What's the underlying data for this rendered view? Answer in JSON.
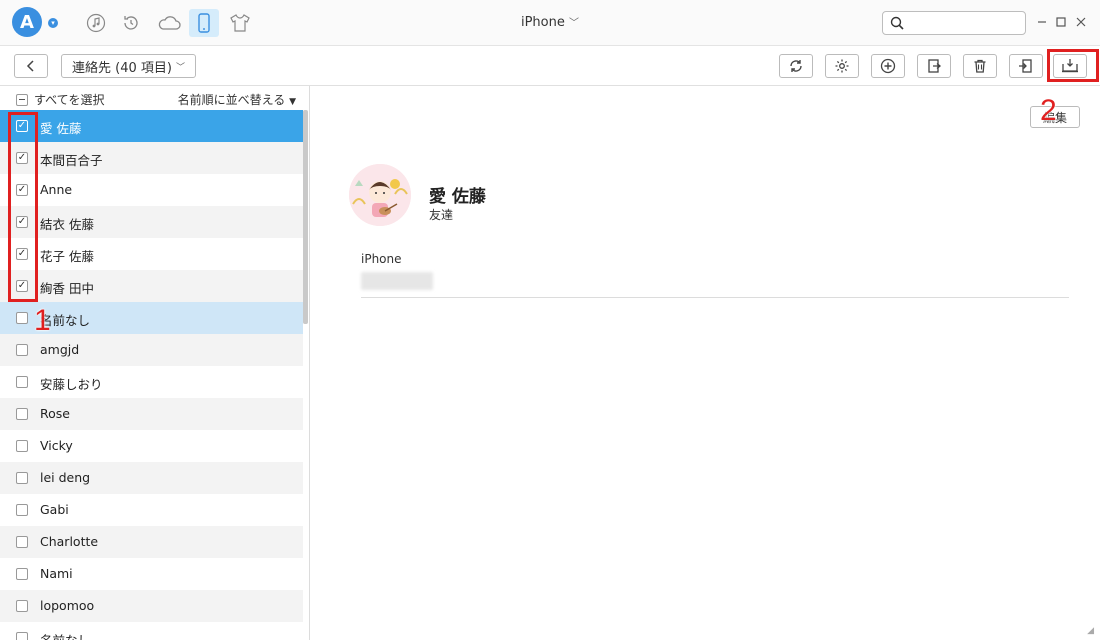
{
  "window": {
    "device_name": "iPhone",
    "search_placeholder": "",
    "nav_icons": [
      "music-note-icon",
      "history-icon",
      "cloud-icon",
      "phone-icon",
      "tshirt-icon"
    ],
    "controls": [
      "minimize",
      "maximize",
      "close"
    ]
  },
  "toolbar": {
    "category_label": "連絡先 (40 項目)",
    "actions": [
      "refresh-icon",
      "settings-icon",
      "add-icon",
      "import-icon",
      "delete-icon",
      "to-device-icon",
      "to-computer-icon"
    ]
  },
  "list": {
    "select_all_label": "すべてを選択",
    "sort_label": "名前順に並べ替える",
    "contacts": [
      {
        "name": "愛 佐藤",
        "checked": true
      },
      {
        "name": "本間百合子",
        "checked": true
      },
      {
        "name": "Anne",
        "checked": true
      },
      {
        "name": "結衣 佐藤",
        "checked": true
      },
      {
        "name": "花子 佐藤",
        "checked": true
      },
      {
        "name": "絢香 田中",
        "checked": true
      },
      {
        "name": "名前なし",
        "checked": false
      },
      {
        "name": "amgjd",
        "checked": false
      },
      {
        "name": "安藤しおり",
        "checked": false
      },
      {
        "name": "Rose",
        "checked": false
      },
      {
        "name": "Vicky",
        "checked": false
      },
      {
        "name": "lei deng",
        "checked": false
      },
      {
        "name": "Gabi",
        "checked": false
      },
      {
        "name": "Charlotte",
        "checked": false
      },
      {
        "name": "Nami",
        "checked": false
      },
      {
        "name": "lopomoo",
        "checked": false
      },
      {
        "name": "名前なし",
        "checked": false
      }
    ]
  },
  "detail": {
    "edit_label": "編集",
    "contact_name": "愛 佐藤",
    "group": "友達",
    "phone_label": "iPhone"
  },
  "annotations": {
    "step1": "1",
    "step2": "2",
    "color": "#e02020"
  },
  "colors": {
    "accent": "#3a8fe0",
    "selected_row": "#3aa4e8",
    "soft_row": "#cfe6f7"
  }
}
